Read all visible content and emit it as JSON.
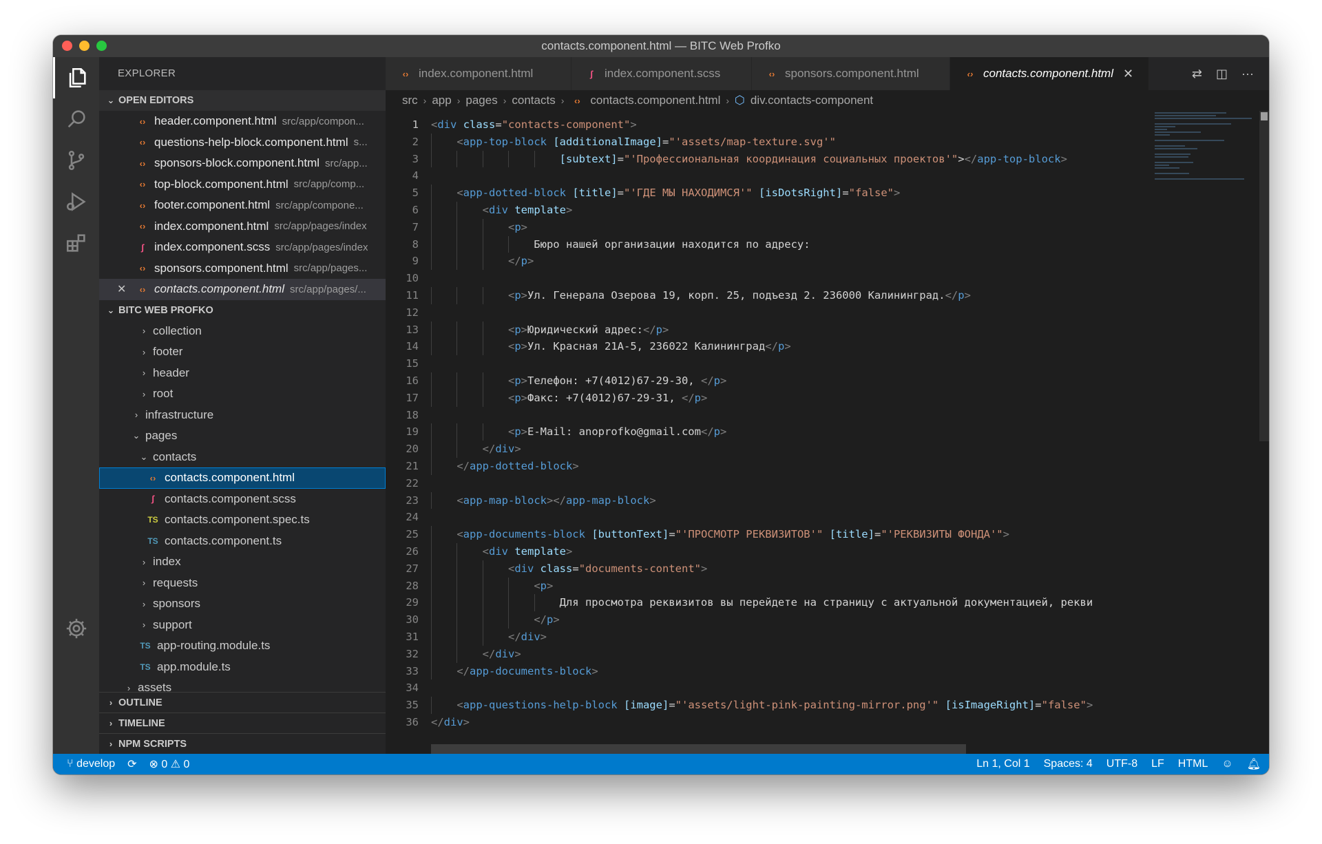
{
  "window": {
    "title": "contacts.component.html — BITC Web Profko"
  },
  "activity_bar": {
    "items": [
      "explorer-icon",
      "search-icon",
      "source-control-icon",
      "run-debug-icon",
      "extensions-icon"
    ],
    "bottom": "gear-icon"
  },
  "sidebar": {
    "title": "EXPLORER",
    "open_editors": {
      "header": "OPEN EDITORS",
      "items": [
        {
          "name": "header.component.html",
          "path": "src/app/compon..."
        },
        {
          "name": "questions-help-block.component.html",
          "path": "s..."
        },
        {
          "name": "sponsors-block.component.html",
          "path": "src/app..."
        },
        {
          "name": "top-block.component.html",
          "path": "src/app/comp..."
        },
        {
          "name": "footer.component.html",
          "path": "src/app/compone..."
        },
        {
          "name": "index.component.html",
          "path": "src/app/pages/index"
        },
        {
          "name": "index.component.scss",
          "path": "src/app/pages/index"
        },
        {
          "name": "sponsors.component.html",
          "path": "src/app/pages..."
        },
        {
          "name": "contacts.component.html",
          "path": "src/app/pages/..."
        }
      ]
    },
    "project": {
      "header": "BITC WEB PROFKO",
      "tree": [
        {
          "label": "collection"
        },
        {
          "label": "footer"
        },
        {
          "label": "header"
        },
        {
          "label": "root"
        },
        {
          "label": "infrastructure"
        },
        {
          "label": "pages"
        },
        {
          "label": "contacts"
        },
        {
          "label": "contacts.component.html"
        },
        {
          "label": "contacts.component.scss"
        },
        {
          "label": "contacts.component.spec.ts"
        },
        {
          "label": "contacts.component.ts"
        },
        {
          "label": "index"
        },
        {
          "label": "requests"
        },
        {
          "label": "sponsors"
        },
        {
          "label": "support"
        },
        {
          "label": "app-routing.module.ts"
        },
        {
          "label": "app.module.ts"
        },
        {
          "label": "assets"
        }
      ]
    },
    "sections": [
      "OUTLINE",
      "TIMELINE",
      "NPM SCRIPTS"
    ]
  },
  "tabs": [
    {
      "label": "index.component.html"
    },
    {
      "label": "index.component.scss"
    },
    {
      "label": "sponsors.component.html"
    },
    {
      "label": "contacts.component.html"
    }
  ],
  "breadcrumb": [
    "src",
    "app",
    "pages",
    "contacts",
    "contacts.component.html",
    "div.contacts-component"
  ],
  "code": {
    "line_numbers": [
      "1",
      "2",
      "3",
      "4",
      "5",
      "6",
      "7",
      "8",
      "9",
      "10",
      "11",
      "12",
      "13",
      "14",
      "15",
      "16",
      "17",
      "18",
      "19",
      "20",
      "21",
      "22",
      "23",
      "24",
      "25",
      "26",
      "27",
      "28",
      "29",
      "30",
      "31",
      "32",
      "33",
      "34",
      "35",
      "36"
    ],
    "lines": [
      "<div class=\"contacts-component\">",
      "    <app-top-block [additionalImage]=\"'assets/map-texture.svg'\"",
      "                    [subtext]=\"'Профессиональная координация социальных проектов'\"></app-top-block>",
      "",
      "    <app-dotted-block [title]=\"'ГДЕ МЫ НАХОДИМСЯ'\" [isDotsRight]=\"false\">",
      "        <div template>",
      "            <p>",
      "                Бюро нашей организации находится по адресу:",
      "            </p>",
      "",
      "            <p>Ул. Генерала Озерова 19, корп. 25, подъезд 2. 236000 Калининград.</p>",
      "",
      "            <p>Юридический адрес:</p>",
      "            <p>Ул. Красная 21А-5, 236022 Калининград</p>",
      "",
      "            <p>Телефон: +7(4012)67-29-30, </p>",
      "            <p>Факс: +7(4012)67-29-31, </p>",
      "",
      "            <p>E-Mail: anoprofko@gmail.com</p>",
      "        </div>",
      "    </app-dotted-block>",
      "",
      "    <app-map-block></app-map-block>",
      "",
      "    <app-documents-block [buttonText]=\"'ПРОСМОТР РЕКВИЗИТОВ'\" [title]=\"'РЕКВИЗИТЫ ФОНДА'\">",
      "        <div template>",
      "            <div class=\"documents-content\">",
      "                <p>",
      "                    Для просмотра реквизитов вы перейдете на страницу с актуальной документацией, рекви",
      "                </p>",
      "            </div>",
      "        </div>",
      "    </app-documents-block>",
      "",
      "    <app-questions-help-block [image]=\"'assets/light-pink-painting-mirror.png'\" [isImageRight]=\"false\">",
      "</div>"
    ]
  },
  "status_bar": {
    "branch": "develop",
    "errors": "0",
    "warnings": "0",
    "cursor": "Ln 1, Col 1",
    "spaces": "Spaces: 4",
    "encoding": "UTF-8",
    "eol": "LF",
    "language": "HTML"
  },
  "colors": {
    "status_bar": "#007acc",
    "selection": "#094771",
    "tag": "#569cd6",
    "attribute": "#9cdcfe",
    "string": "#ce9178"
  }
}
